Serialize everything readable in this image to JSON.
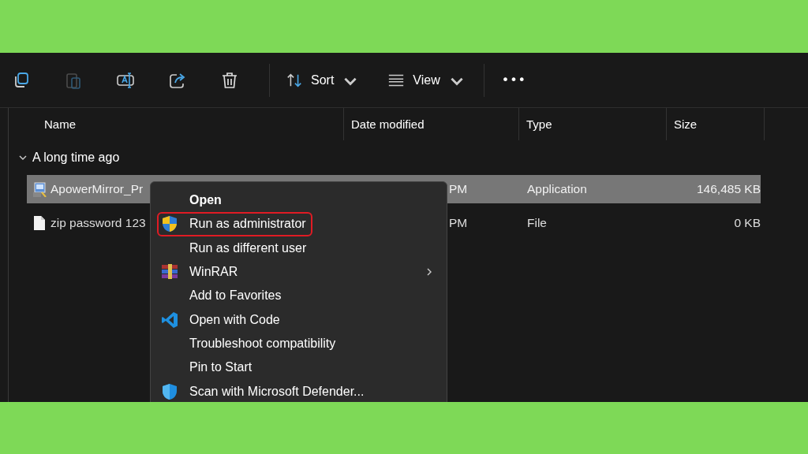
{
  "toolbar": {
    "icon_buttons": [
      {
        "kind": "copy",
        "disabled": false
      },
      {
        "kind": "paste",
        "disabled": true
      },
      {
        "kind": "rename",
        "disabled": false
      },
      {
        "kind": "share",
        "disabled": false
      },
      {
        "kind": "delete",
        "disabled": false
      }
    ],
    "sort": {
      "label": "Sort"
    },
    "view": {
      "label": "View"
    },
    "more": {
      "label": "•••"
    }
  },
  "table": {
    "columns": [
      "Name",
      "Date modified",
      "Type",
      "Size"
    ],
    "group": {
      "label": "A long time ago",
      "expanded": true
    },
    "rows": [
      {
        "kind": "app",
        "name": "ApowerMirror_Pr",
        "date": "PM",
        "type": "Application",
        "size": "146,485 KB",
        "selected": true
      },
      {
        "kind": "file",
        "name": "zip password 123",
        "date": "PM",
        "type": "File",
        "size": "0 KB",
        "selected": false
      }
    ]
  },
  "context_menu": {
    "items": [
      {
        "kind": "plain",
        "label": "Open",
        "bold": true,
        "highlighted": false,
        "submenu": false
      },
      {
        "kind": "shield",
        "label": "Run as administrator",
        "bold": false,
        "highlighted": true,
        "submenu": false
      },
      {
        "kind": "plain",
        "label": "Run as different user",
        "bold": false,
        "highlighted": false,
        "submenu": false
      },
      {
        "kind": "winrar",
        "label": "WinRAR",
        "bold": false,
        "highlighted": false,
        "submenu": true
      },
      {
        "kind": "plain",
        "label": "Add to Favorites",
        "bold": false,
        "highlighted": false,
        "submenu": false
      },
      {
        "kind": "vscode",
        "label": "Open with Code",
        "bold": false,
        "highlighted": false,
        "submenu": false
      },
      {
        "kind": "plain",
        "label": "Troubleshoot compatibility",
        "bold": false,
        "highlighted": false,
        "submenu": false
      },
      {
        "kind": "plain",
        "label": "Pin to Start",
        "bold": false,
        "highlighted": false,
        "submenu": false
      },
      {
        "kind": "defender",
        "label": "Scan with Microsoft Defender...",
        "bold": false,
        "highlighted": false,
        "submenu": false
      }
    ]
  }
}
